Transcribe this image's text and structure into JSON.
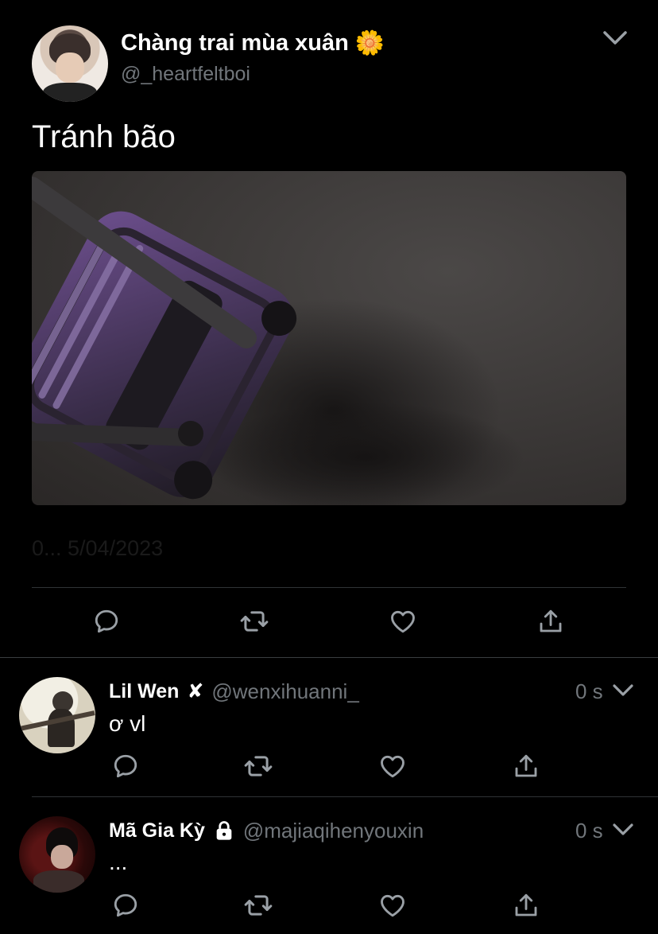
{
  "tweet": {
    "author_name": "Chàng trai mùa xuân",
    "author_emoji": "🌼",
    "handle": "@_heartfeltboi",
    "text": "Tránh bão",
    "timestamp": "0... 5/04/2023",
    "icons": [
      "chevron-down-icon",
      "reply-icon",
      "retweet-icon",
      "like-icon",
      "share-icon"
    ]
  },
  "replies": [
    {
      "name": "Lil Wen",
      "badge": "✘",
      "handle": "@wenxihuanni_",
      "time": "0 s",
      "text": "ơ vl"
    },
    {
      "name": "Mã Gia Kỳ",
      "badge_icon": "lock-icon",
      "handle": "@majiaqihenyouxin",
      "time": "0 s",
      "text": "..."
    }
  ],
  "colors": {
    "background": "#000000",
    "text": "#ffffff",
    "muted": "#71767b",
    "divider": "#2f3336"
  }
}
